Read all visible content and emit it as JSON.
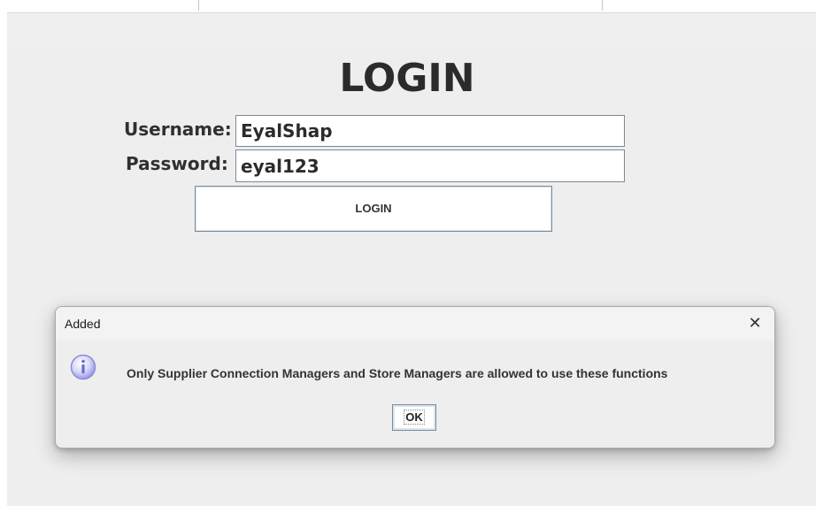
{
  "background_window": {
    "fragment_text": "– – –  ·  · · · ·"
  },
  "login": {
    "title": "LOGIN",
    "username_label": "Username:",
    "username_value": "EyalShap",
    "password_label": "Password:",
    "password_value": "eyal123",
    "button_label": "LOGIN"
  },
  "dialog": {
    "title": "Added",
    "close_glyph": "✕",
    "icon": "info-icon",
    "message": "Only Supplier Connection Managers and Store Managers are allowed to use these functions",
    "ok_label": "OK"
  },
  "colors": {
    "window_bg": "#eeeeee",
    "dialog_bg": "#f0f0f0",
    "info_icon": "#8c8ce0"
  }
}
